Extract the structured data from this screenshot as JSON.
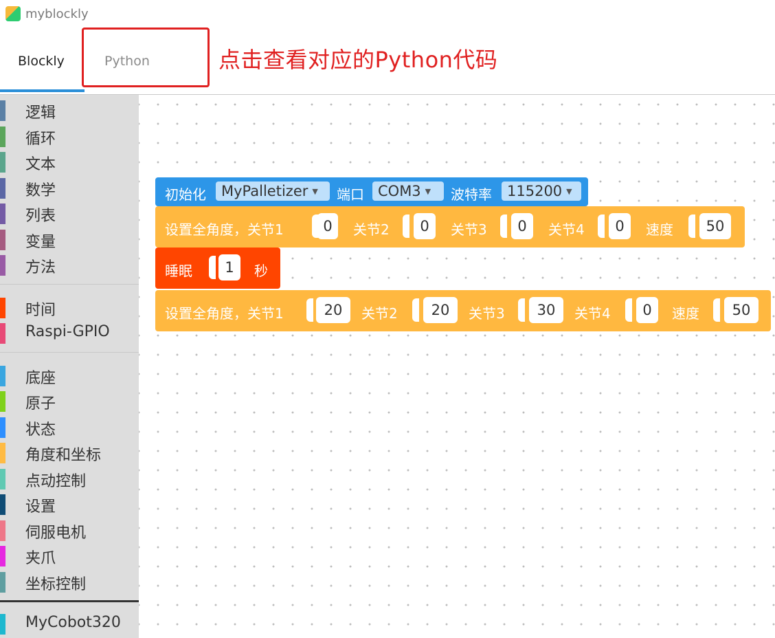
{
  "window": {
    "title": "myblockly"
  },
  "tabs": [
    {
      "label": "Blockly",
      "active": true
    },
    {
      "label": "Python",
      "active": false
    }
  ],
  "annotation": {
    "text": "点击查看对应的Python代码",
    "color": "#e02020"
  },
  "sidebar": {
    "groups": [
      [
        {
          "label": "逻辑",
          "color": "#5b80a5"
        },
        {
          "label": "循环",
          "color": "#5ba55b"
        },
        {
          "label": "文本",
          "color": "#5ba58c"
        },
        {
          "label": "数学",
          "color": "#5b67a5"
        },
        {
          "label": "列表",
          "color": "#745ba5"
        },
        {
          "label": "变量",
          "color": "#a55b80"
        },
        {
          "label": "方法",
          "color": "#995ba5"
        }
      ],
      [
        {
          "label": "时间",
          "color": "#ff4500"
        },
        {
          "label": "Raspi-GPIO",
          "color": "#e84a77"
        }
      ],
      [
        {
          "label": "底座",
          "color": "#3aa6e0"
        },
        {
          "label": "原子",
          "color": "#7fd11b"
        },
        {
          "label": "状态",
          "color": "#2e8fff"
        },
        {
          "label": "角度和坐标",
          "color": "#ffbb44"
        },
        {
          "label": "点动控制",
          "color": "#60c9b2"
        },
        {
          "label": "设置",
          "color": "#0f4c75"
        },
        {
          "label": "伺服电机",
          "color": "#ee7788"
        },
        {
          "label": "夹爪",
          "color": "#e628e0"
        },
        {
          "label": "坐标控制",
          "color": "#5f9ea0"
        }
      ],
      [
        {
          "label": "MyCobot320",
          "color": "#1eb8cf"
        }
      ]
    ]
  },
  "blocks": {
    "init": {
      "label": "初始化",
      "device": "MyPalletizer",
      "port_label": "端口",
      "port": "COM3",
      "baud_label": "波特率",
      "baud": "115200",
      "color": "#2d96e8"
    },
    "set_angles_1": {
      "label": "设置全角度，关节1",
      "j1": "0",
      "j2_label": "关节2",
      "j2": "0",
      "j3_label": "关节3",
      "j3": "0",
      "j4_label": "关节4",
      "j4": "0",
      "speed_label": "速度",
      "speed": "50",
      "color": "#ffb840"
    },
    "sleep": {
      "label": "睡眠",
      "value": "1",
      "unit": "秒",
      "color": "#ff4500"
    },
    "set_angles_2": {
      "label": "设置全角度，关节1",
      "j1": "20",
      "j2_label": "关节2",
      "j2": "20",
      "j3_label": "关节3",
      "j3": "30",
      "j4_label": "关节4",
      "j4": "0",
      "speed_label": "速度",
      "speed": "50",
      "color": "#ffb840"
    }
  }
}
